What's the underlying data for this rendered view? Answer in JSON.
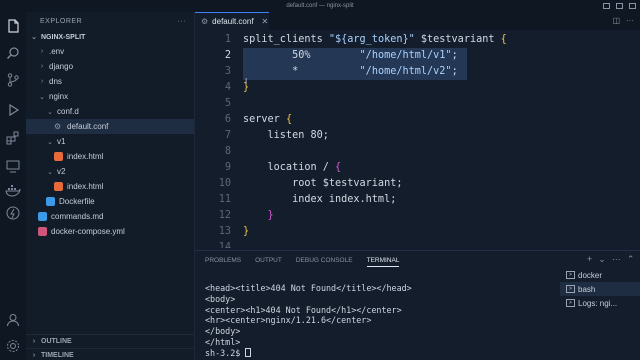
{
  "window": {
    "title": "default.conf — nginx-split"
  },
  "explorer": {
    "header": "EXPLORER",
    "more": "···",
    "root": "NGINX-SPLIT",
    "items": [
      {
        "label": ".env",
        "type": "folder",
        "open": false,
        "depth": 1
      },
      {
        "label": "django",
        "type": "folder",
        "open": false,
        "depth": 1
      },
      {
        "label": "dns",
        "type": "folder",
        "open": false,
        "depth": 1
      },
      {
        "label": "nginx",
        "type": "folder",
        "open": true,
        "depth": 1
      },
      {
        "label": "conf.d",
        "type": "folder",
        "open": true,
        "depth": 2
      },
      {
        "label": "default.conf",
        "type": "file",
        "icon": "gear",
        "depth": 3,
        "selected": true
      },
      {
        "label": "v1",
        "type": "folder",
        "open": true,
        "depth": 2
      },
      {
        "label": "index.html",
        "type": "file",
        "icon": "html",
        "depth": 3
      },
      {
        "label": "v2",
        "type": "folder",
        "open": true,
        "depth": 2
      },
      {
        "label": "index.html",
        "type": "file",
        "icon": "html",
        "depth": 3
      },
      {
        "label": "Dockerfile",
        "type": "file",
        "icon": "docker",
        "depth": 2
      },
      {
        "label": "commands.md",
        "type": "file",
        "icon": "md",
        "depth": 1
      },
      {
        "label": "docker-compose.yml",
        "type": "file",
        "icon": "docker-compose",
        "depth": 1
      }
    ],
    "outline": "OUTLINE",
    "timeline": "TIMELINE"
  },
  "editor": {
    "tab_label": "default.conf",
    "current_line": 2,
    "lines": [
      {
        "n": "1",
        "tokens": [
          [
            "kw",
            "split_clients "
          ],
          [
            "str",
            "\"${arg_token}\""
          ],
          [
            "kw",
            " $testvariant "
          ],
          [
            "brace",
            "{"
          ]
        ]
      },
      {
        "n": "2",
        "tokens": [
          [
            "kw",
            "        50%        "
          ],
          [
            "str",
            "\"/home/html/v1\""
          ],
          [
            "kw",
            ";"
          ]
        ],
        "selected": true
      },
      {
        "n": "3",
        "tokens": [
          [
            "kw",
            "        *          "
          ],
          [
            "str",
            "\"/home/html/v2\""
          ],
          [
            "kw",
            ";"
          ]
        ],
        "selected": true
      },
      {
        "n": "4",
        "tokens": [
          [
            "brace",
            "}"
          ]
        ]
      },
      {
        "n": "5",
        "tokens": []
      },
      {
        "n": "6",
        "tokens": [
          [
            "kw",
            "server "
          ],
          [
            "brace",
            "{"
          ]
        ]
      },
      {
        "n": "7",
        "tokens": [
          [
            "kw",
            "    listen 80;"
          ]
        ]
      },
      {
        "n": "8",
        "tokens": []
      },
      {
        "n": "9",
        "tokens": [
          [
            "kw",
            "    location / "
          ],
          [
            "brace2",
            "{"
          ]
        ]
      },
      {
        "n": "10",
        "tokens": [
          [
            "kw",
            "        root $testvariant;"
          ]
        ]
      },
      {
        "n": "11",
        "tokens": [
          [
            "kw",
            "        index index.html;"
          ]
        ]
      },
      {
        "n": "12",
        "tokens": [
          [
            "brace2",
            "    }"
          ]
        ]
      },
      {
        "n": "13",
        "tokens": [
          [
            "brace",
            "}"
          ]
        ]
      },
      {
        "n": "14",
        "tokens": []
      }
    ]
  },
  "panel": {
    "tabs": [
      "PROBLEMS",
      "OUTPUT",
      "DEBUG CONSOLE",
      "TERMINAL"
    ],
    "active_tab": "TERMINAL",
    "terminal_lines": [
      "<head><title>404 Not Found</title></head>",
      "<body>",
      "<center><h1>404 Not Found</h1></center>",
      "<hr><center>nginx/1.21.6</center>",
      "</body>",
      "</html>",
      "sh-3.2$ "
    ],
    "terminals": [
      {
        "label": "docker",
        "active": false
      },
      {
        "label": "bash",
        "active": true
      },
      {
        "label": "Logs: ngi...",
        "active": false
      }
    ]
  },
  "colors": {
    "accent": "#3b82f6",
    "editor_bg": "#131d2b",
    "selection": "#243754"
  }
}
